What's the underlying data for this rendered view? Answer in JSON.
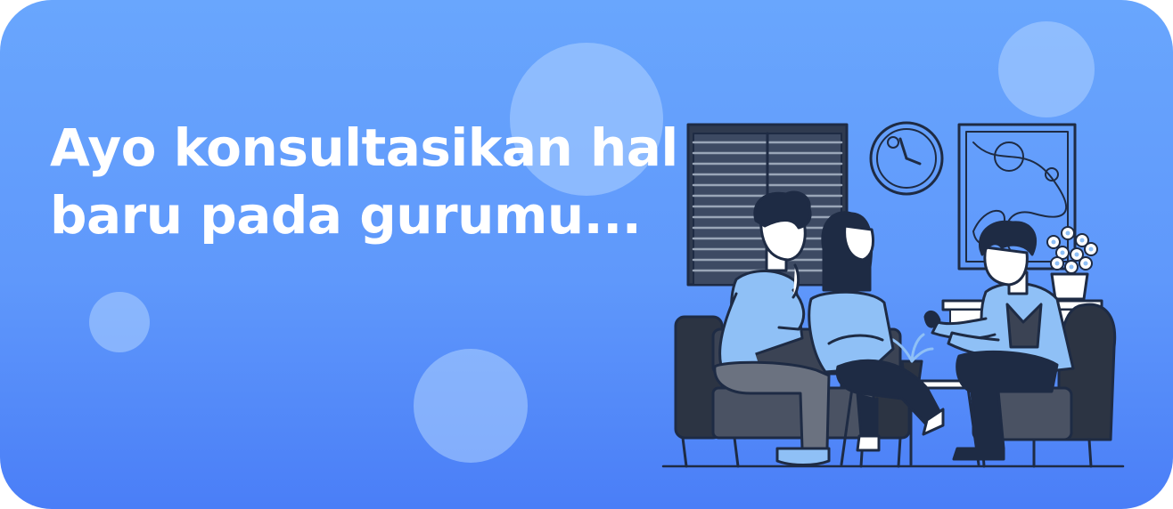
{
  "banner": {
    "headline_line_1": "Ayo konsultasikan hal",
    "headline_line_2": "baru pada gurumu..."
  },
  "colors": {
    "background_top": "#69a6fd",
    "background_bottom": "#4a7ef7",
    "illustration_line": "#1e2b44",
    "illustration_accent": "#8fc0f6"
  },
  "icons": [
    "window-blinds-icon",
    "wall-clock-icon",
    "wall-painting-icon",
    "flower-vase-icon",
    "potted-plant-icon"
  ]
}
